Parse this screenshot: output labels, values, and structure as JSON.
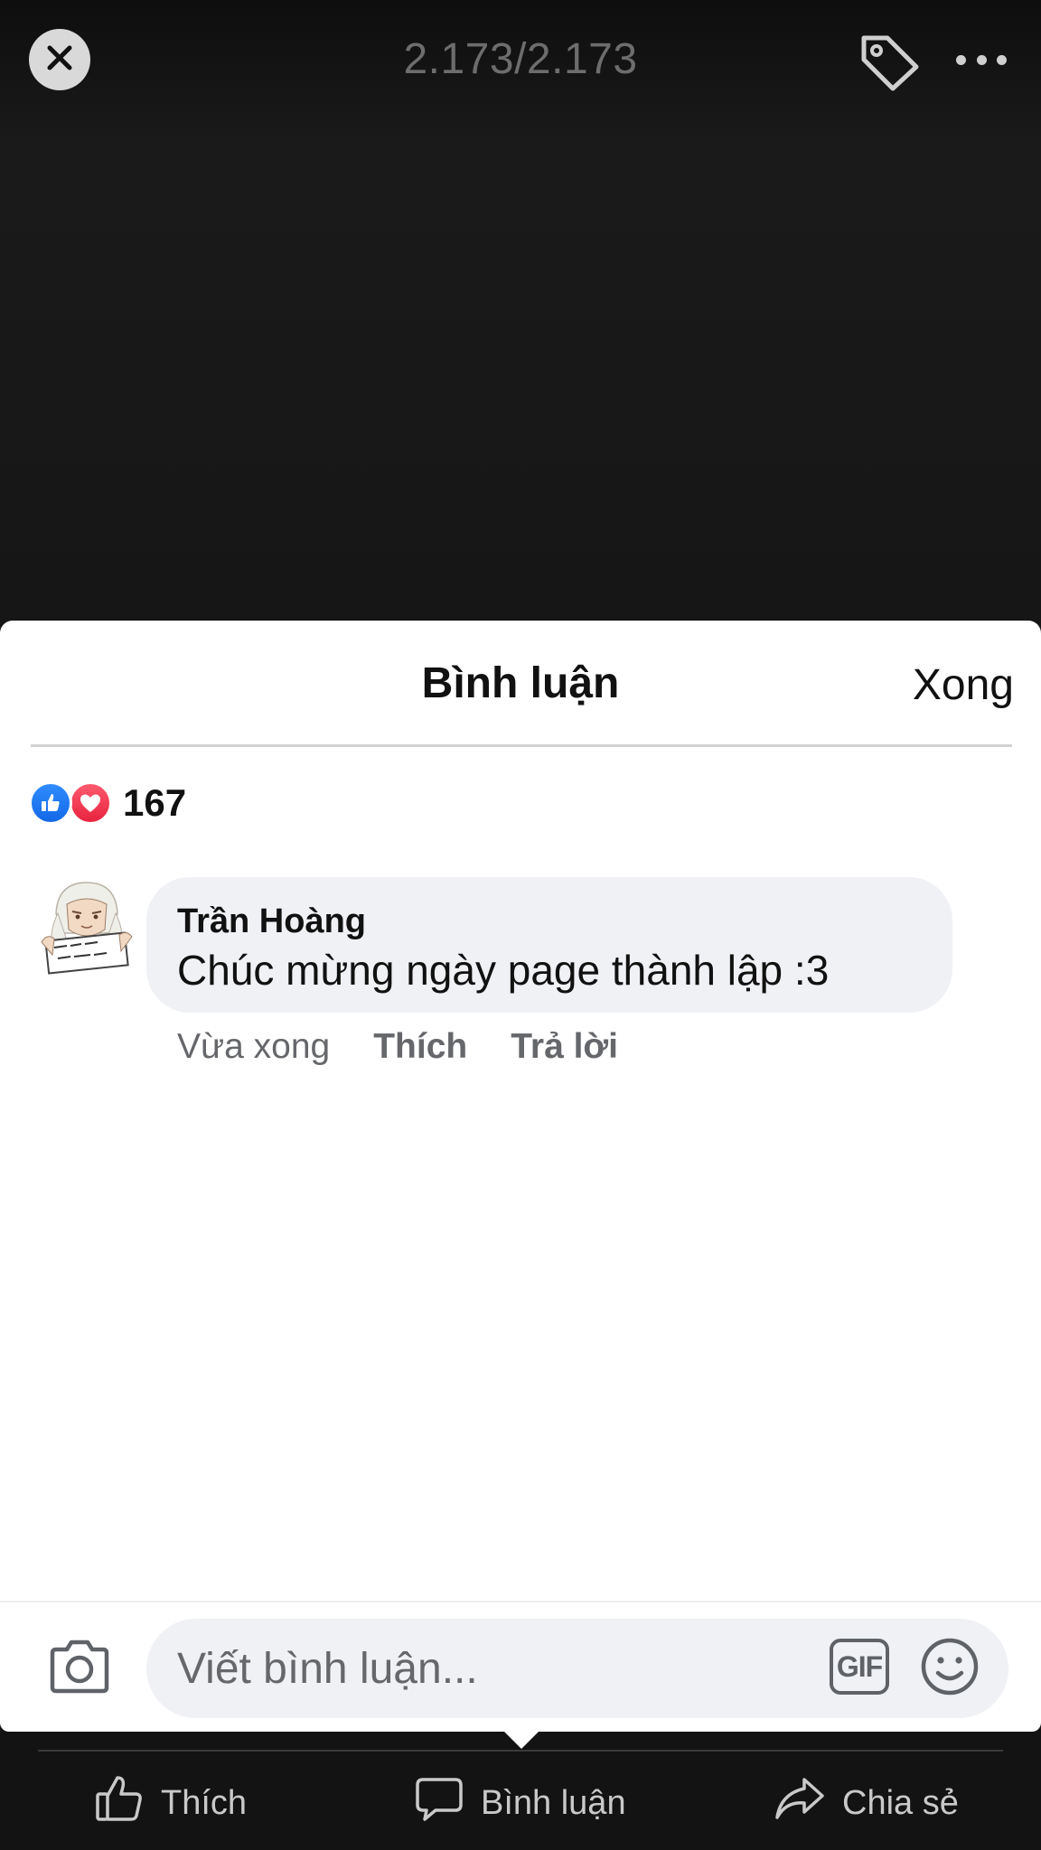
{
  "viewer": {
    "counter": "2.173/2.173",
    "icons": {
      "close": "close-icon",
      "tag": "tag-icon",
      "more": "more-icon"
    }
  },
  "comments_sheet": {
    "title": "Bình luận",
    "done_label": "Xong",
    "reactions": {
      "types": [
        "like",
        "love"
      ],
      "count": "167",
      "colors": {
        "like": "#1877F2",
        "love": "#F0284A"
      }
    },
    "comments": [
      {
        "author": "Trần Hoàng",
        "text": "Chúc mừng ngày page thành lập :3",
        "time": "Vừa xong",
        "like_label": "Thích",
        "reply_label": "Trả lời"
      }
    ],
    "composer": {
      "placeholder": "Viết bình luận...",
      "gif_label": "GIF",
      "icons": [
        "camera-icon",
        "gif-icon",
        "emoji-icon"
      ]
    }
  },
  "action_bar": {
    "like_label": "Thích",
    "comment_label": "Bình luận",
    "share_label": "Chia sẻ"
  }
}
